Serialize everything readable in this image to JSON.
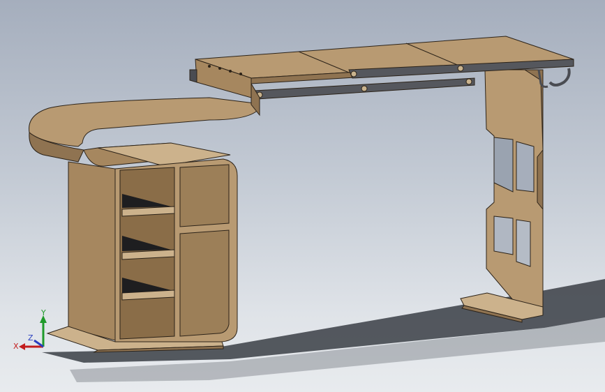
{
  "viewport": {
    "background_top": "#a5aebd",
    "background_bottom": "#e8ebee"
  },
  "model": {
    "wood_color": "#b89a72",
    "wood_dark": "#8f7351",
    "wood_light": "#ccb28c",
    "edge_color": "#2b2218",
    "metal_color": "#4a4c52",
    "shadow_color": "#3a3e45"
  },
  "triad": {
    "x_label": "X",
    "y_label": "Y",
    "z_label": "Z",
    "x_color": "#c21d1d",
    "y_color": "#1f9a2a",
    "z_color": "#2a3fbf"
  }
}
